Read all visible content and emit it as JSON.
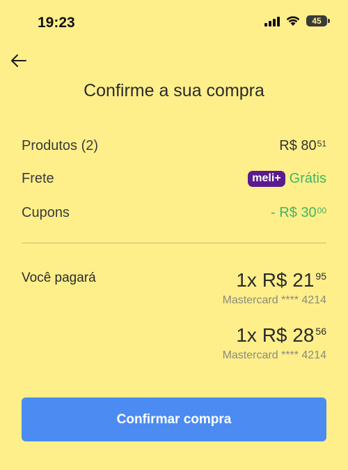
{
  "status_bar": {
    "time": "19:23",
    "battery": "45",
    "icons": [
      "cellular-signal-icon",
      "wifi-icon",
      "battery-icon"
    ]
  },
  "header": {
    "back_icon": "back-arrow-icon",
    "title": "Confirme a sua compra"
  },
  "summary": {
    "products": {
      "label": "Produtos (2)",
      "amount_main": "R$ 80",
      "amount_cents": "51"
    },
    "shipping": {
      "label": "Frete",
      "badge": "meli+",
      "value": "Grátis"
    },
    "coupons": {
      "label": "Cupons",
      "amount_main": "- R$ 30",
      "amount_cents": "00"
    }
  },
  "payment": {
    "label": "Você pagará",
    "installments": [
      {
        "amount_main": "1x R$ 21",
        "amount_cents": "95",
        "card": "Mastercard **** 4214"
      },
      {
        "amount_main": "1x R$ 28",
        "amount_cents": "56",
        "card": "Mastercard **** 4214"
      }
    ]
  },
  "actions": {
    "confirm_label": "Confirmar compra"
  },
  "colors": {
    "background": "#FFEF8B",
    "primary_button": "#4C8BF1",
    "success_green": "#3fb660",
    "meli_badge": "#5b1b8e"
  }
}
